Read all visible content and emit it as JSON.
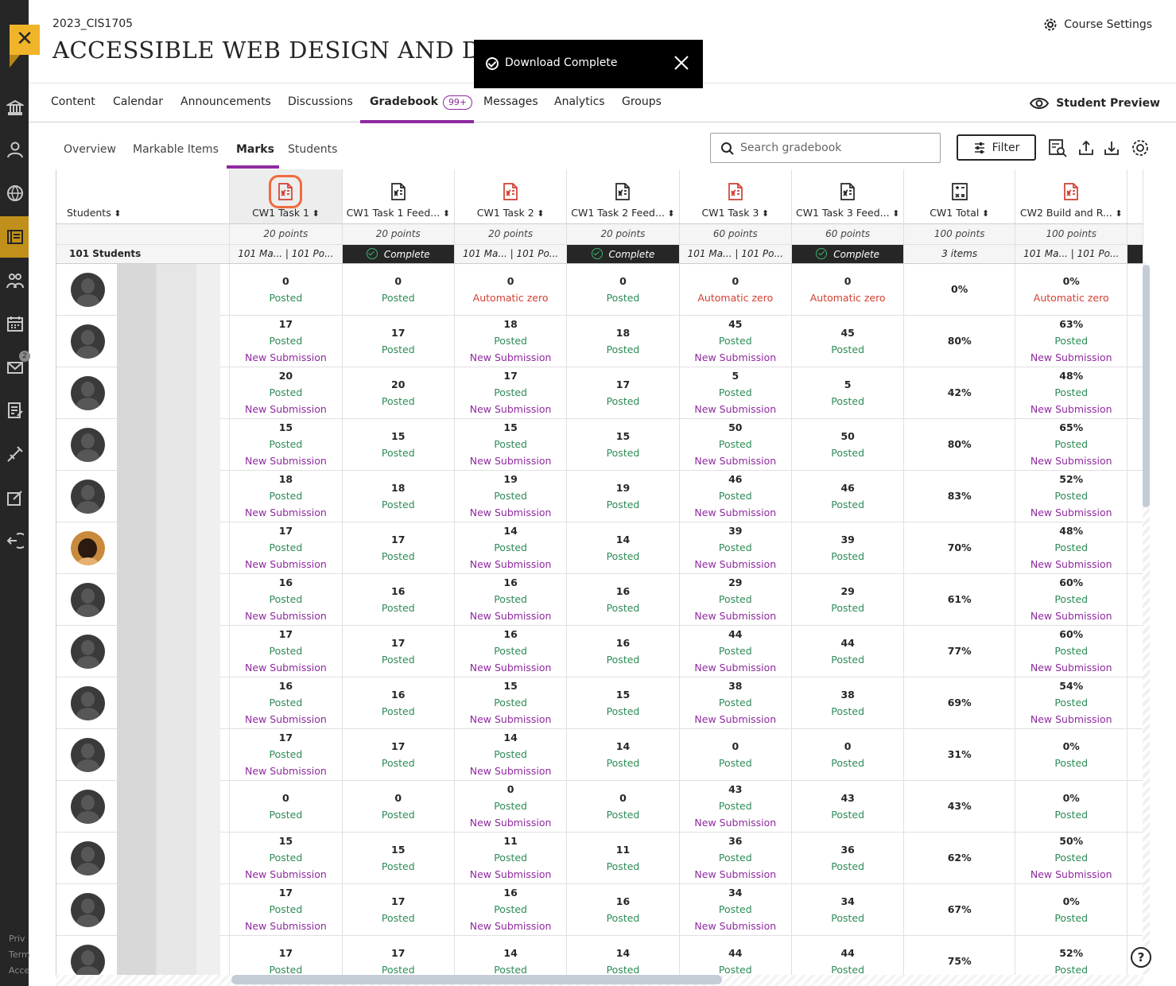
{
  "rail": {
    "close_label": "✕",
    "icons": [
      "institution-icon",
      "profile-icon",
      "globe-icon",
      "courses-icon",
      "groups-icon",
      "calendar-icon",
      "messages-icon",
      "grades-icon",
      "tools-icon",
      "edit-icon",
      "sign-out-icon"
    ],
    "messages_badge": "2",
    "footer": [
      "Priv",
      "Term",
      "Acce"
    ]
  },
  "header": {
    "course_code": "2023_CIS1705",
    "course_title": "ACCESSIBLE WEB DESIGN AND DEVE",
    "course_settings": "Course Settings"
  },
  "toast": {
    "message": "Download Complete"
  },
  "topnav": {
    "items": [
      "Content",
      "Calendar",
      "Announcements",
      "Discussions",
      "Gradebook",
      "Messages",
      "Analytics",
      "Groups"
    ],
    "gradebook_badge": "99+",
    "active": "Gradebook",
    "student_preview": "Student Preview"
  },
  "subnav": {
    "items": [
      "Overview",
      "Markable Items",
      "Marks",
      "Students"
    ],
    "active": "Marks"
  },
  "toolbar": {
    "search_placeholder": "Search gradebook",
    "filter_label": "Filter"
  },
  "gradebook": {
    "students_header": "Students",
    "student_count": "101 Students",
    "columns": [
      {
        "name": "CW1 Task 1",
        "icon": "assignment-icon",
        "icon_color": "#d23f31",
        "points": "20 points",
        "summary": "101 Ma... | 101 Po...",
        "summary_type": "count"
      },
      {
        "name": "CW1 Task 1 Feed...",
        "icon": "assignment-icon",
        "icon_color": "#262626",
        "points": "20 points",
        "summary": "Complete",
        "summary_type": "complete"
      },
      {
        "name": "CW1 Task 2",
        "icon": "assignment-icon",
        "icon_color": "#d23f31",
        "points": "20 points",
        "summary": "101 Ma... | 101 Po...",
        "summary_type": "count"
      },
      {
        "name": "CW1 Task 2 Feed...",
        "icon": "assignment-icon",
        "icon_color": "#262626",
        "points": "20 points",
        "summary": "Complete",
        "summary_type": "complete"
      },
      {
        "name": "CW1 Task 3",
        "icon": "assignment-icon",
        "icon_color": "#d23f31",
        "points": "60 points",
        "summary": "101 Ma... | 101 Po...",
        "summary_type": "count"
      },
      {
        "name": "CW1 Task 3 Feed...",
        "icon": "assignment-icon",
        "icon_color": "#262626",
        "points": "60 points",
        "summary": "Complete",
        "summary_type": "complete"
      },
      {
        "name": "CW1 Total",
        "icon": "calculation-icon",
        "icon_color": "#262626",
        "points": "100 points",
        "summary": "3 items",
        "summary_type": "count"
      },
      {
        "name": "CW2 Build and R...",
        "icon": "assignment-icon",
        "icon_color": "#d23f31",
        "points": "100 points",
        "summary": "101 Ma... | 101 Po...",
        "summary_type": "count"
      }
    ],
    "rows": [
      {
        "avatar": "default-slash",
        "cells": [
          [
            "0",
            "Posted",
            ""
          ],
          [
            "0",
            "Posted",
            ""
          ],
          [
            "0",
            "Automatic zero",
            ""
          ],
          [
            "0",
            "Posted",
            ""
          ],
          [
            "0",
            "Automatic zero",
            ""
          ],
          [
            "0",
            "Automatic zero",
            ""
          ],
          [
            "0%",
            "",
            ""
          ],
          [
            "0%",
            "Automatic zero",
            ""
          ]
        ]
      },
      {
        "avatar": "default",
        "cells": [
          [
            "17",
            "Posted",
            "New Submission"
          ],
          [
            "17",
            "Posted",
            ""
          ],
          [
            "18",
            "Posted",
            "New Submission"
          ],
          [
            "18",
            "Posted",
            ""
          ],
          [
            "45",
            "Posted",
            "New Submission"
          ],
          [
            "45",
            "Posted",
            ""
          ],
          [
            "80%",
            "",
            ""
          ],
          [
            "63%",
            "Posted",
            "New Submission"
          ]
        ]
      },
      {
        "avatar": "default",
        "cells": [
          [
            "20",
            "Posted",
            "New Submission"
          ],
          [
            "20",
            "Posted",
            ""
          ],
          [
            "17",
            "Posted",
            "New Submission"
          ],
          [
            "17",
            "Posted",
            ""
          ],
          [
            "5",
            "Posted",
            "New Submission"
          ],
          [
            "5",
            "Posted",
            ""
          ],
          [
            "42%",
            "",
            ""
          ],
          [
            "48%",
            "Posted",
            "New Submission"
          ]
        ]
      },
      {
        "avatar": "default",
        "cells": [
          [
            "15",
            "Posted",
            "New Submission"
          ],
          [
            "15",
            "Posted",
            ""
          ],
          [
            "15",
            "Posted",
            "New Submission"
          ],
          [
            "15",
            "Posted",
            ""
          ],
          [
            "50",
            "Posted",
            "New Submission"
          ],
          [
            "50",
            "Posted",
            ""
          ],
          [
            "80%",
            "",
            ""
          ],
          [
            "65%",
            "Posted",
            "New Submission"
          ]
        ]
      },
      {
        "avatar": "default",
        "cells": [
          [
            "18",
            "Posted",
            "New Submission"
          ],
          [
            "18",
            "Posted",
            ""
          ],
          [
            "19",
            "Posted",
            "New Submission"
          ],
          [
            "19",
            "Posted",
            ""
          ],
          [
            "46",
            "Posted",
            "New Submission"
          ],
          [
            "46",
            "Posted",
            ""
          ],
          [
            "83%",
            "",
            ""
          ],
          [
            "52%",
            "Posted",
            "New Submission"
          ]
        ]
      },
      {
        "avatar": "photo",
        "cells": [
          [
            "17",
            "Posted",
            "New Submission"
          ],
          [
            "17",
            "Posted",
            ""
          ],
          [
            "14",
            "Posted",
            "New Submission"
          ],
          [
            "14",
            "Posted",
            ""
          ],
          [
            "39",
            "Posted",
            "New Submission"
          ],
          [
            "39",
            "Posted",
            ""
          ],
          [
            "70%",
            "",
            ""
          ],
          [
            "48%",
            "Posted",
            "New Submission"
          ]
        ]
      },
      {
        "avatar": "default",
        "cells": [
          [
            "16",
            "Posted",
            "New Submission"
          ],
          [
            "16",
            "Posted",
            ""
          ],
          [
            "16",
            "Posted",
            "New Submission"
          ],
          [
            "16",
            "Posted",
            ""
          ],
          [
            "29",
            "Posted",
            "New Submission"
          ],
          [
            "29",
            "Posted",
            ""
          ],
          [
            "61%",
            "",
            ""
          ],
          [
            "60%",
            "Posted",
            "New Submission"
          ]
        ]
      },
      {
        "avatar": "default",
        "cells": [
          [
            "17",
            "Posted",
            "New Submission"
          ],
          [
            "17",
            "Posted",
            ""
          ],
          [
            "16",
            "Posted",
            "New Submission"
          ],
          [
            "16",
            "Posted",
            ""
          ],
          [
            "44",
            "Posted",
            "New Submission"
          ],
          [
            "44",
            "Posted",
            ""
          ],
          [
            "77%",
            "",
            ""
          ],
          [
            "60%",
            "Posted",
            "New Submission"
          ]
        ]
      },
      {
        "avatar": "default",
        "cells": [
          [
            "16",
            "Posted",
            "New Submission"
          ],
          [
            "16",
            "Posted",
            ""
          ],
          [
            "15",
            "Posted",
            "New Submission"
          ],
          [
            "15",
            "Posted",
            ""
          ],
          [
            "38",
            "Posted",
            "New Submission"
          ],
          [
            "38",
            "Posted",
            ""
          ],
          [
            "69%",
            "",
            ""
          ],
          [
            "54%",
            "Posted",
            "New Submission"
          ]
        ]
      },
      {
        "avatar": "default",
        "cells": [
          [
            "17",
            "Posted",
            "New Submission"
          ],
          [
            "17",
            "Posted",
            ""
          ],
          [
            "14",
            "Posted",
            "New Submission"
          ],
          [
            "14",
            "Posted",
            ""
          ],
          [
            "0",
            "Posted",
            ""
          ],
          [
            "0",
            "Posted",
            ""
          ],
          [
            "31%",
            "",
            ""
          ],
          [
            "0%",
            "Posted",
            ""
          ]
        ]
      },
      {
        "avatar": "default",
        "cells": [
          [
            "0",
            "Posted",
            ""
          ],
          [
            "0",
            "Posted",
            ""
          ],
          [
            "0",
            "Posted",
            "New Submission"
          ],
          [
            "0",
            "Posted",
            ""
          ],
          [
            "43",
            "Posted",
            "New Submission"
          ],
          [
            "43",
            "Posted",
            ""
          ],
          [
            "43%",
            "",
            ""
          ],
          [
            "0%",
            "Posted",
            ""
          ]
        ]
      },
      {
        "avatar": "default",
        "cells": [
          [
            "15",
            "Posted",
            "New Submission"
          ],
          [
            "15",
            "Posted",
            ""
          ],
          [
            "11",
            "Posted",
            "New Submission"
          ],
          [
            "11",
            "Posted",
            ""
          ],
          [
            "36",
            "Posted",
            "New Submission"
          ],
          [
            "36",
            "Posted",
            ""
          ],
          [
            "62%",
            "",
            ""
          ],
          [
            "50%",
            "Posted",
            "New Submission"
          ]
        ]
      },
      {
        "avatar": "default",
        "cells": [
          [
            "17",
            "Posted",
            "New Submission"
          ],
          [
            "17",
            "Posted",
            ""
          ],
          [
            "16",
            "Posted",
            "New Submission"
          ],
          [
            "16",
            "Posted",
            ""
          ],
          [
            "34",
            "Posted",
            "New Submission"
          ],
          [
            "34",
            "Posted",
            ""
          ],
          [
            "67%",
            "",
            ""
          ],
          [
            "0%",
            "Posted",
            ""
          ]
        ]
      },
      {
        "avatar": "default",
        "cells": [
          [
            "17",
            "Posted",
            ""
          ],
          [
            "17",
            "Posted",
            ""
          ],
          [
            "14",
            "Posted",
            ""
          ],
          [
            "14",
            "Posted",
            ""
          ],
          [
            "44",
            "Posted",
            ""
          ],
          [
            "44",
            "Posted",
            ""
          ],
          [
            "75%",
            "",
            ""
          ],
          [
            "52%",
            "Posted",
            ""
          ]
        ]
      }
    ]
  },
  "help_label": "?"
}
